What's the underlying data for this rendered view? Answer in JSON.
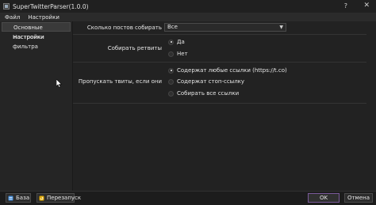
{
  "window": {
    "title": "SuperTwitterParser(1.0.0)",
    "help": "?",
    "close": "✕"
  },
  "menu": [
    "Файл",
    "Настройки"
  ],
  "sidebar": {
    "items": [
      {
        "label": "Основные настройки",
        "active": true
      },
      {
        "label": "Настройки фильтра",
        "active": false
      }
    ]
  },
  "settings": {
    "posts_count": {
      "label": "Сколько постов собирать",
      "value": "Все"
    },
    "retweets": {
      "label": "Собирать ретвиты",
      "options": [
        "Да",
        "Нет"
      ],
      "selected": "Да"
    },
    "skip": {
      "label": "Пропускать твиты, если они",
      "options": [
        "Содержат любые ссылки (https://t.co)",
        "Содержат стоп-ссылку",
        "Собирать все ссылки"
      ],
      "selected": "Содержат любые ссылки (https://t.co)"
    }
  },
  "footer": {
    "base_label": "База",
    "restart_label": "Перезапуск",
    "ok_label": "OK",
    "cancel_label": "Отмена"
  },
  "colors": {
    "background": "#1e1e1e",
    "panel": "#222222",
    "accent_border": "#7a5a9a",
    "base_icon": "#4a90d9",
    "restart_icon": "#e0a800"
  },
  "icons": {
    "app": "app-icon",
    "base": "database-icon",
    "restart": "restart-icon",
    "cursor": "mouse-cursor-icon"
  }
}
